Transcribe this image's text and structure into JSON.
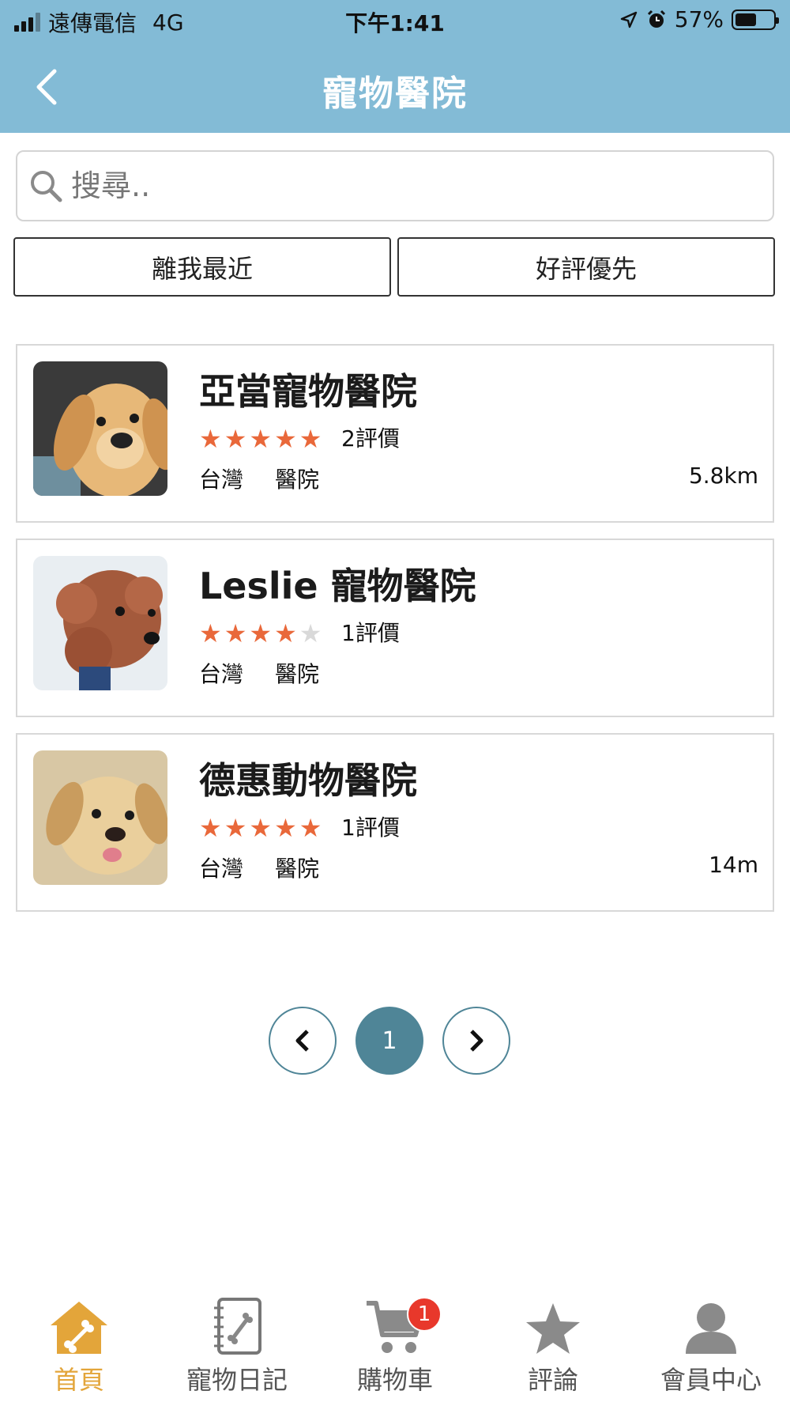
{
  "status_bar": {
    "carrier": "遠傳電信",
    "network": "4G",
    "time": "下午1:41",
    "battery": "57%",
    "battery_level": 0.57
  },
  "header": {
    "back_icon": "chevron-left-icon",
    "title": "寵物醫院"
  },
  "search": {
    "placeholder": "搜尋..",
    "value": ""
  },
  "filters": [
    "離我最近",
    "好評優先"
  ],
  "clinics": [
    {
      "name": "亞當寵物醫院",
      "rating": 5,
      "reviews": "2評價",
      "region": "台灣",
      "category": "醫院",
      "distance": "5.8km",
      "image": "golden-retriever-puppy"
    },
    {
      "name": "Leslie 寵物醫院",
      "rating": 4,
      "reviews": "1評價",
      "region": "台灣",
      "category": "醫院",
      "distance": "",
      "image": "poodle"
    },
    {
      "name": "德惠動物醫院",
      "rating": 5,
      "reviews": "1評價",
      "region": "台灣",
      "category": "醫院",
      "distance": "14m",
      "image": "labrador-puppy"
    }
  ],
  "pagination": {
    "prev_icon": "chevron-left-icon",
    "current": "1",
    "next_icon": "chevron-right-icon"
  },
  "tabbar": [
    {
      "label": "首頁",
      "icon": "home-bone-icon",
      "active": true
    },
    {
      "label": "寵物日記",
      "icon": "notebook-icon",
      "active": false
    },
    {
      "label": "購物車",
      "icon": "cart-icon",
      "active": false,
      "badge": "1"
    },
    {
      "label": "評論",
      "icon": "star-icon",
      "active": false
    },
    {
      "label": "會員中心",
      "icon": "user-icon",
      "active": false
    }
  ],
  "colors": {
    "header_bg": "#83bbd6",
    "star": "#e9683a",
    "pager": "#4f8597",
    "tab_active": "#e3a53a",
    "badge": "#e8382b"
  }
}
